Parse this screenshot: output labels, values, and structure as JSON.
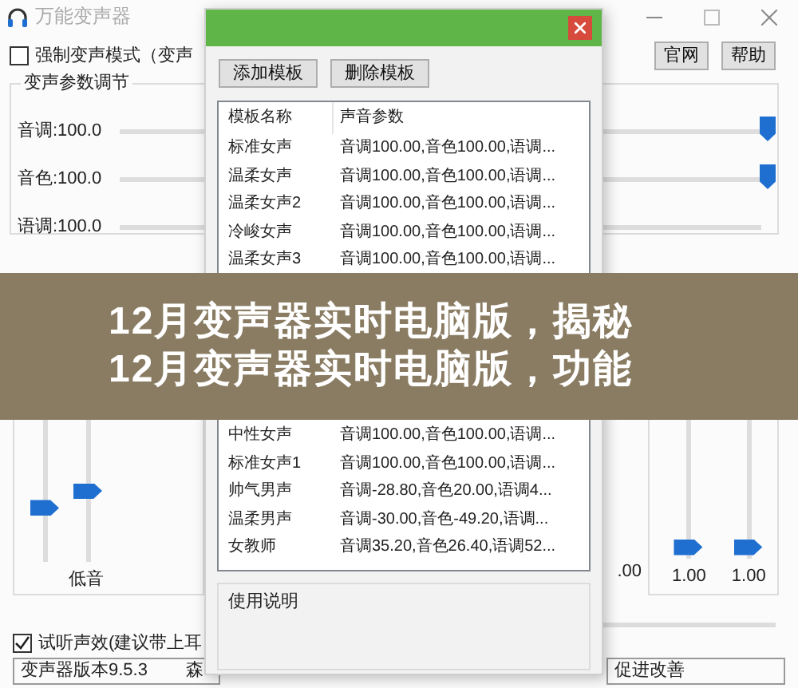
{
  "main_window": {
    "title": "万能变声器",
    "force_mode": {
      "label": "强制变声模式（变声",
      "checked": false
    },
    "top_buttons": [
      "官网",
      "帮助"
    ],
    "params_group": {
      "title": "变声参数调节",
      "sliders": [
        {
          "label": "音调:100.0",
          "level": 1
        },
        {
          "label": "音色:100.0",
          "level": 1
        },
        {
          "label": "语调:100.0"
        }
      ]
    },
    "eq_left": {
      "label": "低音",
      "sliders": [
        {
          "level": 0.38
        },
        {
          "level": 0.5
        }
      ]
    },
    "eq_right": {
      "cut_label": ".00",
      "sliders": [
        {
          "level": 0,
          "reading": "1.00"
        },
        {
          "level": 0,
          "reading": "1.00"
        }
      ]
    },
    "preview": {
      "label": "试听声效(建议带上耳",
      "checked": true
    },
    "status_bar": [
      "变声器版本9.5.3",
      "森",
      "促进改善"
    ]
  },
  "dialog": {
    "buttons": [
      "添加模板",
      "删除模板"
    ],
    "columns": [
      "模板名称",
      "声音参数"
    ],
    "rows_top": [
      {
        "name": "标准女声",
        "params": "音调100.00,音色100.00,语调..."
      },
      {
        "name": "温柔女声",
        "params": "音调100.00,音色100.00,语调..."
      },
      {
        "name": "温柔女声2",
        "params": "音调100.00,音色100.00,语调..."
      },
      {
        "name": "冷峻女声",
        "params": "音调100.00,音色100.00,语调..."
      },
      {
        "name": "温柔女声3",
        "params": "音调100.00,音色100.00,语调..."
      }
    ],
    "rows_bottom": [
      {
        "name": "中性女声",
        "params": "音调100.00,音色100.00,语调..."
      },
      {
        "name": "标准女声1",
        "params": "音调100.00,音色100.00,语调..."
      },
      {
        "name": "帅气男声",
        "params": "音调-28.80,音色20.00,语调4..."
      },
      {
        "name": "温柔男声",
        "params": "音调-30.00,音色-49.20,语调..."
      },
      {
        "name": "女教师",
        "params": "音调35.20,音色26.40,语调52..."
      }
    ],
    "help_group": {
      "title": "使用说明"
    }
  },
  "banner": {
    "lines": [
      "12月变声器实时电脑版，揭秘",
      "12月变声器实时电脑版，功能"
    ]
  }
}
